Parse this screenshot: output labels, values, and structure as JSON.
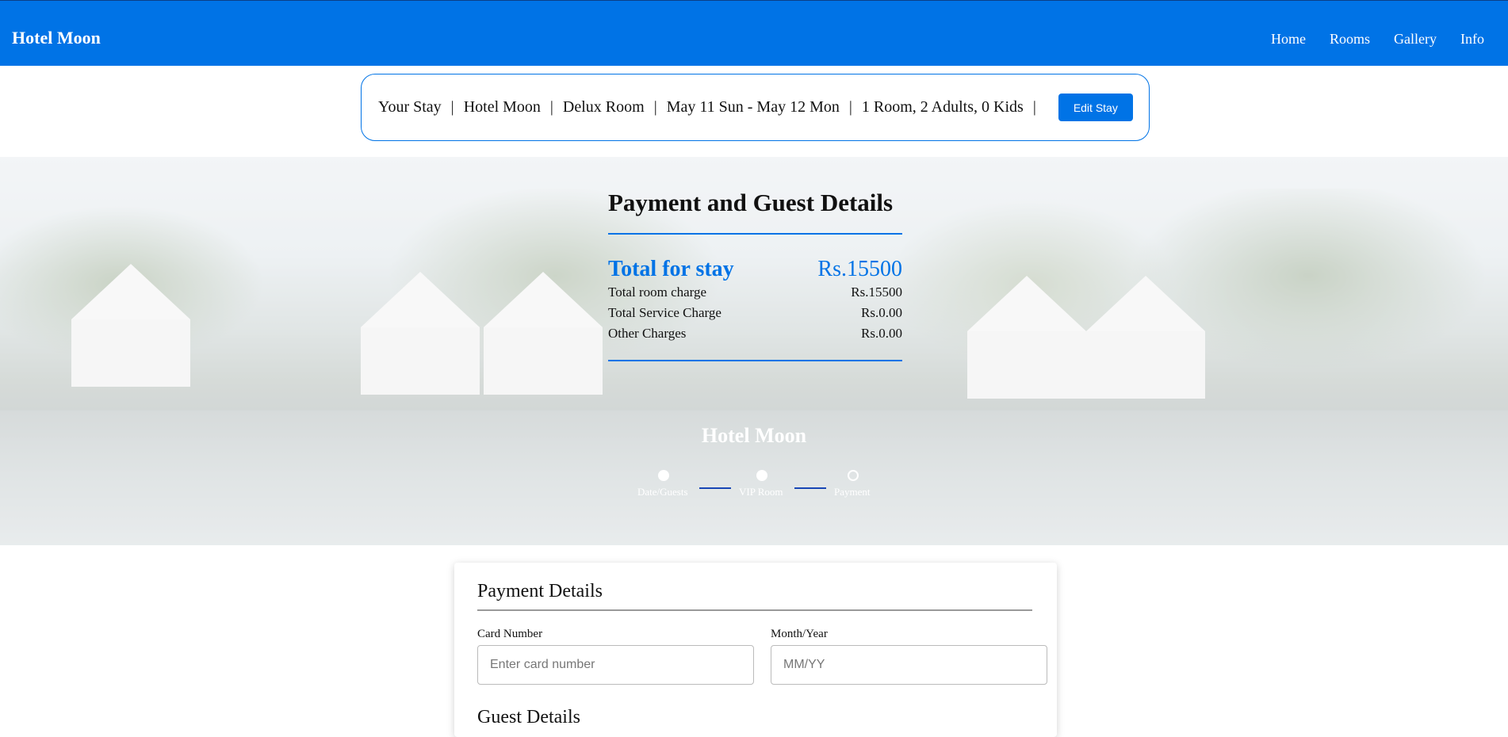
{
  "navbar": {
    "brand": "Hotel Moon",
    "links": [
      "Home",
      "Rooms",
      "Gallery",
      "Info"
    ]
  },
  "stay": {
    "label": "Your Stay",
    "hotel": "Hotel Moon",
    "room": "Delux Room",
    "dates": "May 11 Sun - May 12 Mon",
    "occupancy": "1 Room, 2 Adults, 0 Kids",
    "separator": "|",
    "edit_button": "Edit Stay"
  },
  "summary": {
    "title": "Payment and Guest Details",
    "total_label": "Total for stay",
    "total_value": "Rs.15500",
    "charges": [
      {
        "label": "Total room charge",
        "value": "Rs.15500"
      },
      {
        "label": "Total Service Charge",
        "value": "Rs.0.00"
      },
      {
        "label": "Other Charges",
        "value": "Rs.0.00"
      }
    ]
  },
  "hero": {
    "title": "Hotel Moon"
  },
  "steps": [
    {
      "label": "Date/Guests",
      "state": "complete"
    },
    {
      "label": "VIP Room",
      "state": "complete"
    },
    {
      "label": "Payment",
      "state": "current"
    }
  ],
  "payment": {
    "title": "Payment Details",
    "card_number_label": "Card Number",
    "card_number_placeholder": "Enter card number",
    "month_year_label": "Month/Year",
    "month_year_placeholder": "MM/YY"
  },
  "guest": {
    "title": "Guest Details"
  },
  "colors": {
    "primary": "#0073e6",
    "step_line": "#1846b5"
  }
}
